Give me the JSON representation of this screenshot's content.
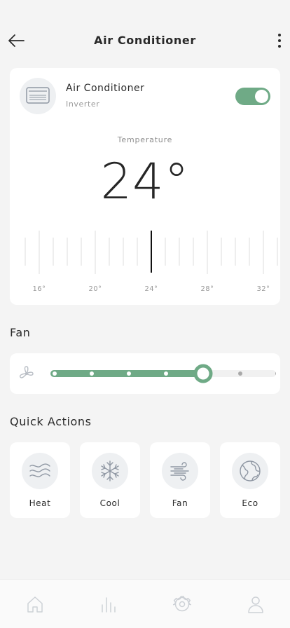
{
  "header": {
    "title": "Air Conditioner",
    "back_icon": "arrow-left-icon",
    "more_icon": "more-vertical-icon"
  },
  "device": {
    "name": "Air Conditioner",
    "subtitle": "Inverter",
    "icon": "air-conditioner-icon",
    "power_on": true
  },
  "temperature": {
    "label": "Temperature",
    "value": "24°",
    "current": 24,
    "min": 15,
    "max": 34,
    "tick_labels": [
      "16°",
      "20°",
      "24°",
      "28°",
      "32°"
    ]
  },
  "fan": {
    "title": "Fan",
    "icon": "fan-icon",
    "level": 5,
    "levels": 7
  },
  "quick_actions": {
    "title": "Quick Actions",
    "items": [
      {
        "label": "Heat",
        "icon": "heat-waves-icon"
      },
      {
        "label": "Cool",
        "icon": "snowflake-icon"
      },
      {
        "label": "Fan",
        "icon": "wind-icon"
      },
      {
        "label": "Eco",
        "icon": "globe-leaf-icon"
      }
    ]
  },
  "bottom_nav": {
    "items": [
      {
        "icon": "home-icon"
      },
      {
        "icon": "stats-icon"
      },
      {
        "icon": "settings-icon"
      },
      {
        "icon": "profile-icon"
      }
    ]
  },
  "colors": {
    "accent": "#6faa86",
    "card": "#ffffff",
    "background": "#f4f4f4",
    "icon_gray": "#8f97a3"
  }
}
